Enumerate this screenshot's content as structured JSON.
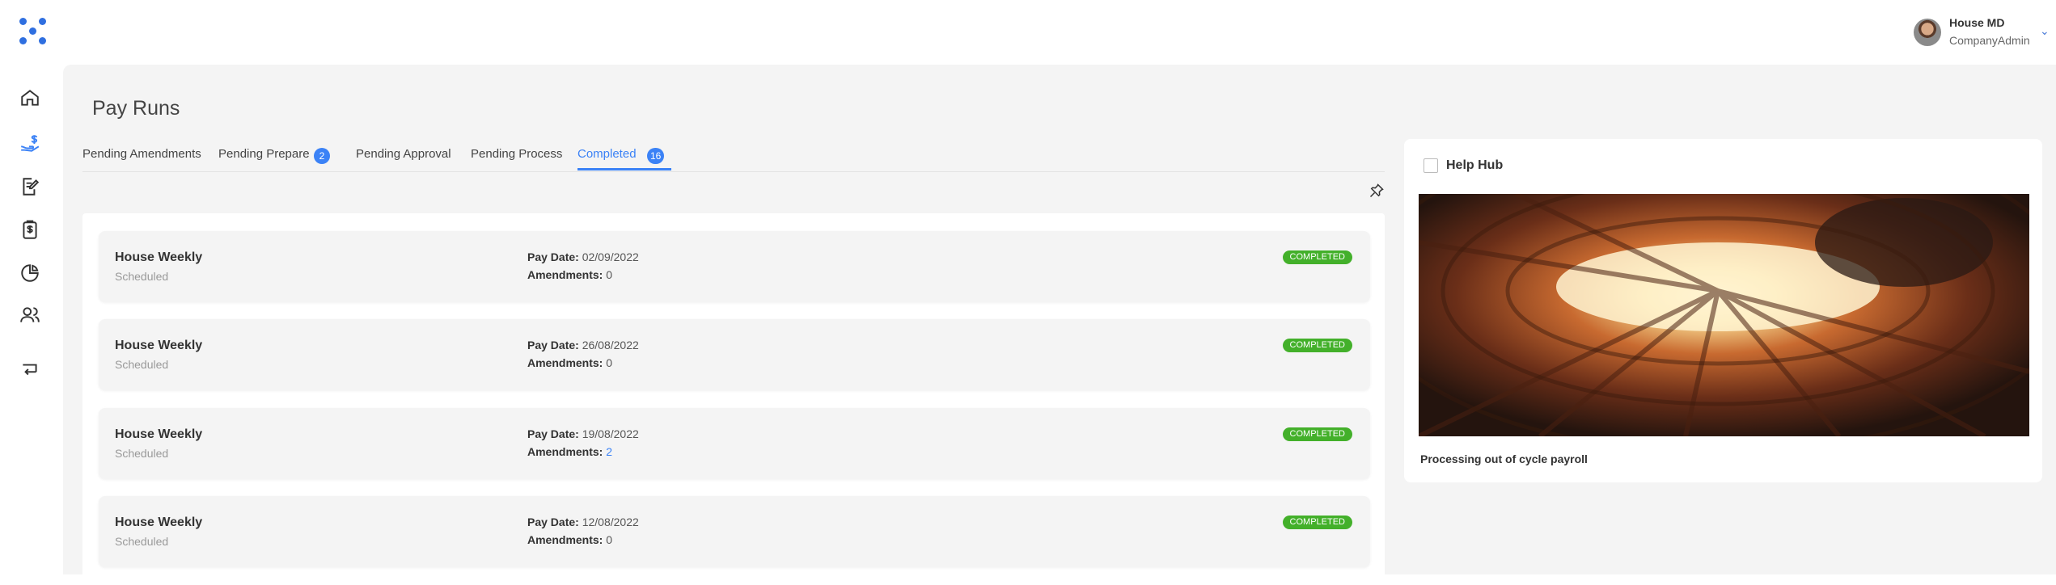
{
  "user": {
    "name": "House MD",
    "role": "CompanyAdmin"
  },
  "nav": [
    "home-icon",
    "payroll-icon",
    "edit-document-icon",
    "invoice-icon",
    "reports-pie-icon",
    "people-icon",
    "exit-icon"
  ],
  "page": {
    "title": "Pay Runs"
  },
  "tabs": [
    {
      "label": "Pending Amendments"
    },
    {
      "label": "Pending Prepare",
      "badge": "2"
    },
    {
      "label": "Pending Approval"
    },
    {
      "label": "Pending Process"
    },
    {
      "label": "Completed",
      "badge": "16"
    }
  ],
  "active_tab": "Completed",
  "runs": [
    {
      "name": "House Weekly",
      "sub": "Scheduled",
      "pay_date_label": "Pay Date:",
      "pay_date": "02/09/2022",
      "amend_label": "Amendments:",
      "amendments": "0",
      "status": "COMPLETED"
    },
    {
      "name": "House Weekly",
      "sub": "Scheduled",
      "pay_date_label": "Pay Date:",
      "pay_date": "26/08/2022",
      "amend_label": "Amendments:",
      "amendments": "0",
      "status": "COMPLETED"
    },
    {
      "name": "House Weekly",
      "sub": "Scheduled",
      "pay_date_label": "Pay Date:",
      "pay_date": "19/08/2022",
      "amend_label": "Amendments:",
      "amendments": "2",
      "status": "COMPLETED"
    },
    {
      "name": "House Weekly",
      "sub": "Scheduled",
      "pay_date_label": "Pay Date:",
      "pay_date": "12/08/2022",
      "amend_label": "Amendments:",
      "amendments": "0",
      "status": "COMPLETED"
    }
  ],
  "helphub": {
    "title": "Help Hub",
    "caption": "Processing out of cycle payroll"
  },
  "colors": {
    "accent": "#3b82f6",
    "status_completed": "#43b02a",
    "background": "#f4f4f4"
  }
}
